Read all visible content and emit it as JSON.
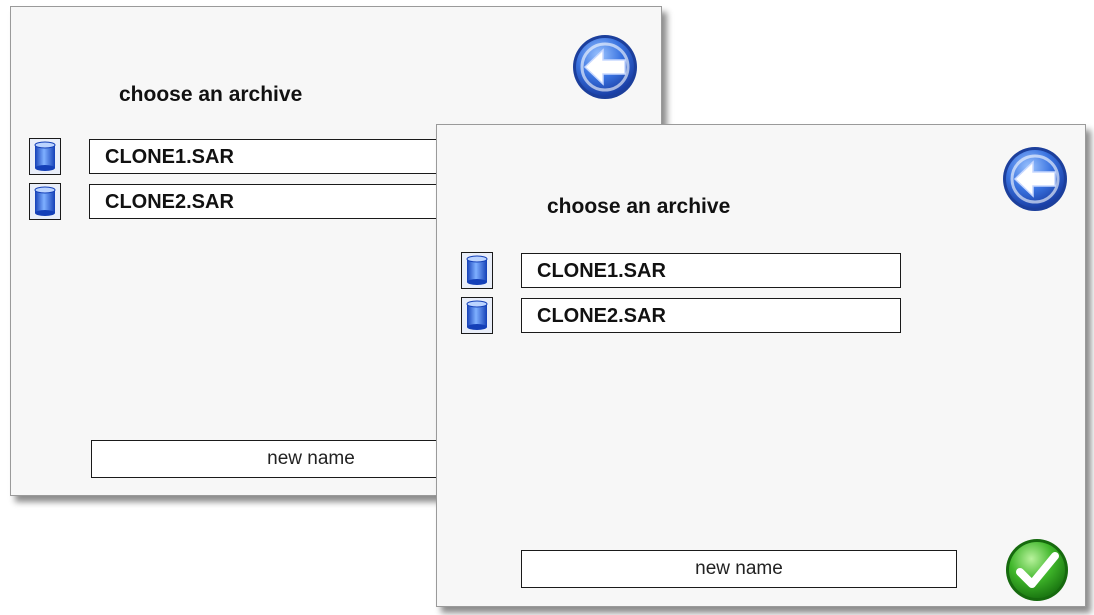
{
  "dialogs": [
    {
      "title": "choose an archive",
      "archives": [
        {
          "label": "CLONE1.SAR",
          "icon": "database-icon"
        },
        {
          "label": "CLONE2.SAR",
          "icon": "database-icon"
        }
      ],
      "new_name_label": "new name",
      "back_icon": "back-arrow-icon"
    },
    {
      "title": "choose an archive",
      "archives": [
        {
          "label": "CLONE1.SAR",
          "icon": "database-icon"
        },
        {
          "label": "CLONE2.SAR",
          "icon": "database-icon"
        }
      ],
      "new_name_label": "new name",
      "back_icon": "back-arrow-icon",
      "confirm_icon": "checkmark-icon"
    }
  ],
  "colors": {
    "panel_background": "#f7f7f7",
    "icon_blue": "#2a62d8",
    "confirm_green": "#2fa01e",
    "border": "#1a1a1a"
  }
}
